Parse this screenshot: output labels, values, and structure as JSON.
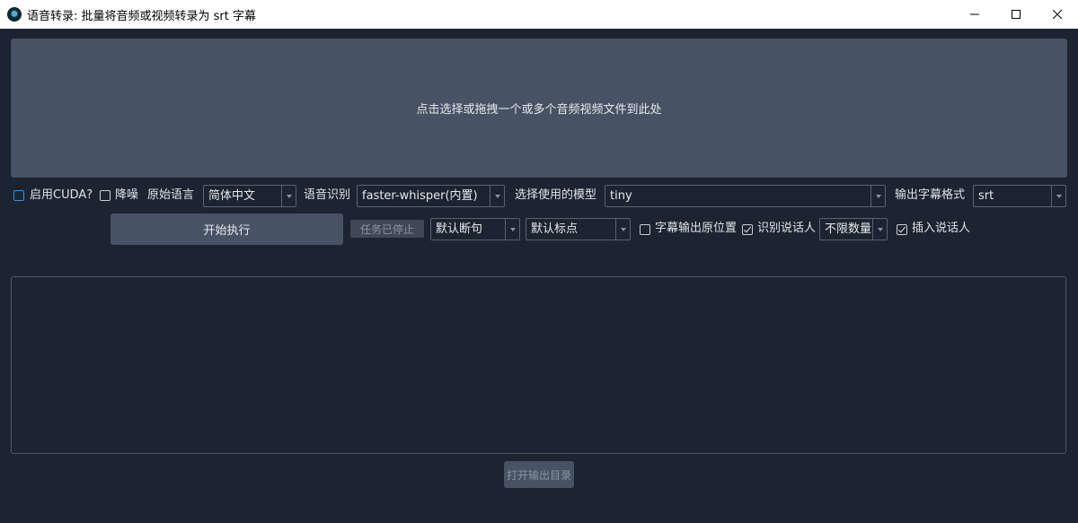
{
  "window": {
    "title": "语音转录: 批量将音频或视频转录为 srt 字幕",
    "icon": "app-logo-icon"
  },
  "dropzone": {
    "text": "点击选择或拖拽一个或多个音频视频文件到此处"
  },
  "row1": {
    "cuda_label": "启用CUDA?",
    "cuda_checked": false,
    "denoise_label": "降噪",
    "denoise_checked": false,
    "language_label": "原始语言",
    "language_value": "简体中文",
    "recognition_label": "语音识别",
    "recognition_value": "faster-whisper(内置)",
    "model_label": "选择使用的模型",
    "model_value": "tiny",
    "format_label": "输出字幕格式",
    "format_value": "srt"
  },
  "row2": {
    "start_button": "开始执行",
    "stop_button": "任务已停止",
    "split_value": "默认断句",
    "punct_value": "默认标点",
    "original_pos_label": "字幕输出原位置",
    "original_pos_checked": false,
    "speaker_label": "识别说话人",
    "speaker_checked": true,
    "speaker_count_value": "不限数量",
    "insert_speaker_label": "插入说话人",
    "insert_speaker_checked": true
  },
  "footer": {
    "open_output_button": "打开输出目录"
  },
  "colors": {
    "background": "#1b2430",
    "panel": "#475364",
    "accent_checkbox": "#3d8fe0"
  }
}
